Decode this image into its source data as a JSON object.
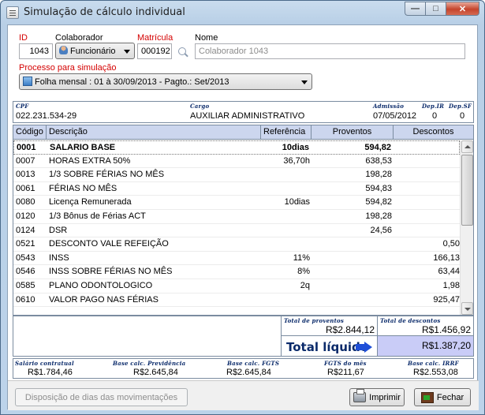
{
  "window": {
    "title": "Simulação de cálculo individual"
  },
  "form": {
    "id_label": "ID",
    "id_value": "1043",
    "colaborador_label": "Colaborador",
    "colaborador_type": "Funcionário",
    "matricula_label": "Matrícula",
    "matricula_value": "000192",
    "nome_label": "Nome",
    "nome_placeholder": "Colaborador 1043",
    "processo_label": "Processo para simulação",
    "processo_value": "Folha mensal : 01 à 30/09/2013 - Pagto.: Set/2013"
  },
  "info": {
    "cpf_label": "CPF",
    "cpf_value": "022.231.534-29",
    "cargo_label": "Cargo",
    "cargo_value": "AUXILIAR ADMINISTRATIVO",
    "admissao_label": "Admissão",
    "admissao_value": "07/05/2012",
    "dep_ir_label": "Dep.IR",
    "dep_ir_value": "0",
    "dep_sf_label": "Dep.SF",
    "dep_sf_value": "0"
  },
  "table": {
    "headers": {
      "codigo": "Código",
      "descricao": "Descrição",
      "referencia": "Referência",
      "proventos": "Proventos",
      "descontos": "Descontos"
    },
    "rows": [
      {
        "codigo": "0001",
        "descricao": "SALARIO BASE",
        "referencia": "10dias",
        "proventos": "594,82",
        "descontos": ""
      },
      {
        "codigo": "0007",
        "descricao": "HORAS EXTRA 50%",
        "referencia": "36,70h",
        "proventos": "638,53",
        "descontos": ""
      },
      {
        "codigo": "0013",
        "descricao": "1/3 SOBRE FÉRIAS NO MÊS",
        "referencia": "",
        "proventos": "198,28",
        "descontos": ""
      },
      {
        "codigo": "0061",
        "descricao": "FÉRIAS NO MÊS",
        "referencia": "",
        "proventos": "594,83",
        "descontos": ""
      },
      {
        "codigo": "0080",
        "descricao": "Licença Remunerada",
        "referencia": "10dias",
        "proventos": "594,82",
        "descontos": ""
      },
      {
        "codigo": "0120",
        "descricao": "1/3 Bônus de Férias ACT",
        "referencia": "",
        "proventos": "198,28",
        "descontos": ""
      },
      {
        "codigo": "0124",
        "descricao": "DSR",
        "referencia": "",
        "proventos": "24,56",
        "descontos": ""
      },
      {
        "codigo": "0521",
        "descricao": "DESCONTO VALE REFEIÇÃO",
        "referencia": "",
        "proventos": "",
        "descontos": "0,50"
      },
      {
        "codigo": "0543",
        "descricao": "INSS",
        "referencia": "11%",
        "proventos": "",
        "descontos": "166,13"
      },
      {
        "codigo": "0546",
        "descricao": "INSS SOBRE FÉRIAS NO MÊS",
        "referencia": "8%",
        "proventos": "",
        "descontos": "63,44"
      },
      {
        "codigo": "0585",
        "descricao": "PLANO ODONTOLOGICO",
        "referencia": "2q",
        "proventos": "",
        "descontos": "1,98"
      },
      {
        "codigo": "0610",
        "descricao": "VALOR PAGO NAS FÉRIAS",
        "referencia": "",
        "proventos": "",
        "descontos": "925,47"
      }
    ]
  },
  "totals": {
    "proventos_label": "Total de proventos",
    "proventos_value": "R$2.844,12",
    "descontos_label": "Total de descontos",
    "descontos_value": "R$1.456,92",
    "liquido_label": "Total líquido",
    "liquido_value": "R$1.387,20"
  },
  "bases": {
    "salario_label": "Salário contratual",
    "salario_value": "R$1.784,46",
    "previdencia_label": "Base calc. Previdência",
    "previdencia_value": "R$2.645,84",
    "fgts_label": "Base calc. FGTS",
    "fgts_value": "R$2.645,84",
    "fgts_mes_label": "FGTS do mês",
    "fgts_mes_value": "R$211,67",
    "irrf_label": "Base calc. IRRF",
    "irrf_value": "R$2.553,08"
  },
  "footer": {
    "disposicao_label": "Disposição de dias das movimentações",
    "imprimir_label": "Imprimir",
    "fechar_label": "Fechar"
  },
  "colors": {
    "header_bg": "#ccd6ee",
    "liquido_bg": "#c9ccf7",
    "label_blue": "#0a2a6a",
    "required_red": "#d40000"
  }
}
